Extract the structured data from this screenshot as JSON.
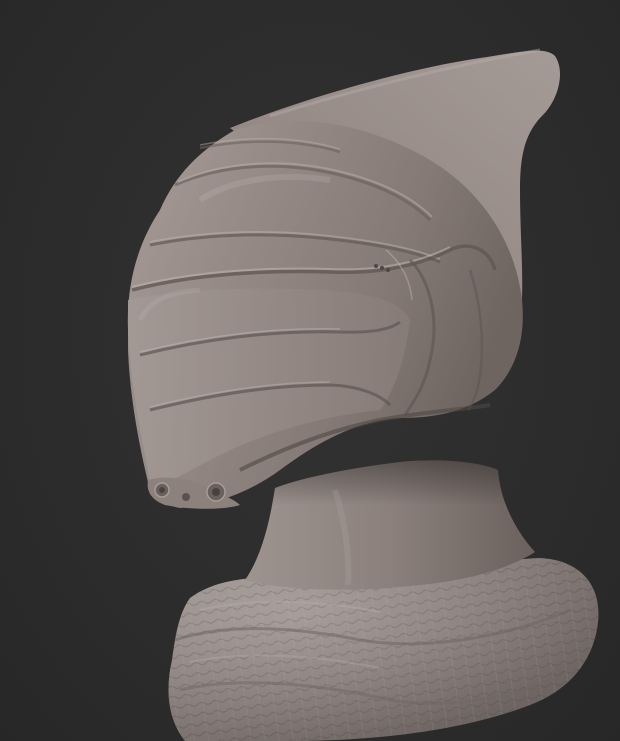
{
  "scene": {
    "background_color": "#2d2d2d",
    "material_color": "#8f8480",
    "subject_parts": [
      "helmet",
      "neck",
      "collar"
    ]
  }
}
